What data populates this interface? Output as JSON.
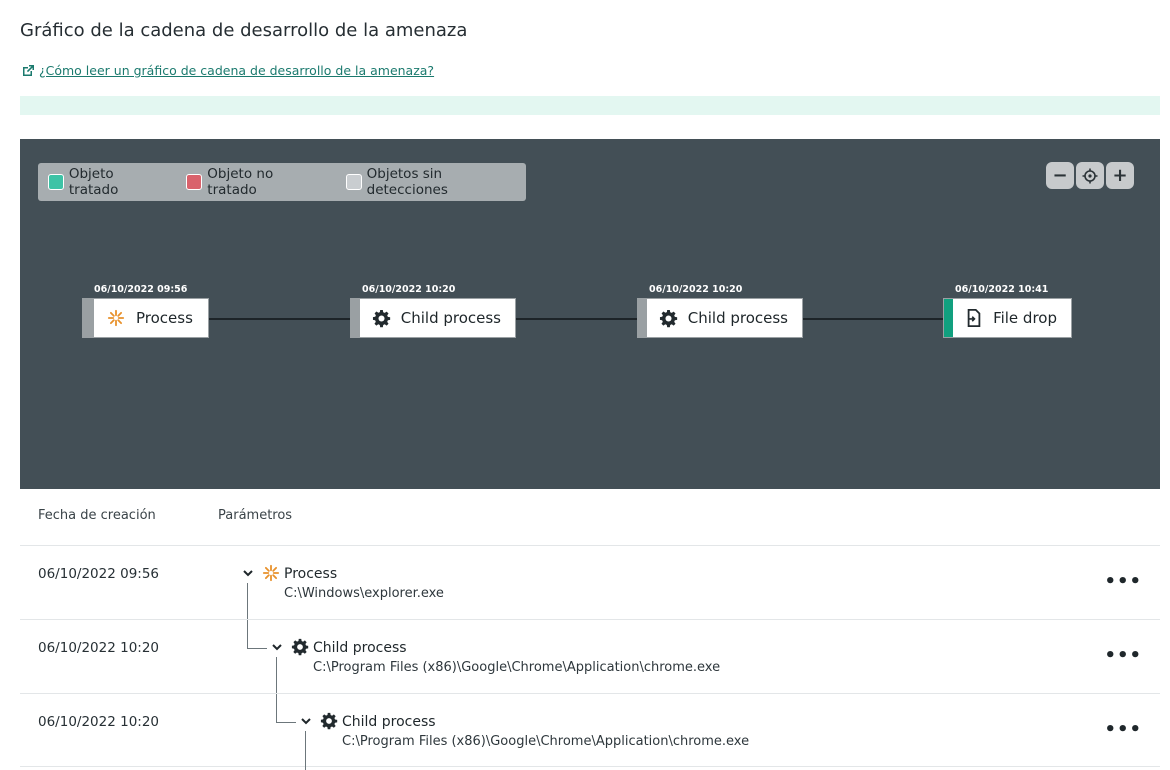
{
  "page": {
    "title": "Gráfico de la cadena de desarrollo de la amenaza",
    "help_link": "¿Cómo leer un gráfico de cadena de desarrollo de la amenaza?"
  },
  "legend": {
    "items": [
      {
        "label": "Objeto tratado",
        "color": "#3ec3a6"
      },
      {
        "label": "Objeto no tratado",
        "color": "#d9626c"
      },
      {
        "label": "Objetos sin detecciones",
        "color": "#c9cdd0"
      }
    ]
  },
  "zoom": {
    "out_label": "−",
    "in_label": "+"
  },
  "chain": {
    "nodes": [
      {
        "time": "06/10/2022 09:56",
        "label": "Process",
        "icon": "process-icon"
      },
      {
        "time": "06/10/2022 10:20",
        "label": "Child process",
        "icon": "gear-icon"
      },
      {
        "time": "06/10/2022 10:20",
        "label": "Child process",
        "icon": "gear-icon"
      },
      {
        "time": "06/10/2022 10:41",
        "label": "File drop",
        "icon": "file-drop-icon"
      }
    ]
  },
  "table": {
    "headers": {
      "date": "Fecha de creación",
      "params": "Parámetros"
    },
    "rows": [
      {
        "date": "06/10/2022 09:56",
        "name": "Process",
        "path": "C:\\Windows\\explorer.exe",
        "icon": "process-icon"
      },
      {
        "date": "06/10/2022 10:20",
        "name": "Child process",
        "path": "C:\\Program Files (x86)\\Google\\Chrome\\Application\\chrome.exe",
        "icon": "gear-icon"
      },
      {
        "date": "06/10/2022 10:20",
        "name": "Child process",
        "path": "C:\\Program Files (x86)\\Google\\Chrome\\Application\\chrome.exe",
        "icon": "gear-icon"
      }
    ],
    "menu_label": "•••"
  },
  "colors": {
    "treated": "#11a07f",
    "neutral": "#9aa0a3",
    "accent": "#e8912b",
    "graph_bg": "#434f56"
  }
}
